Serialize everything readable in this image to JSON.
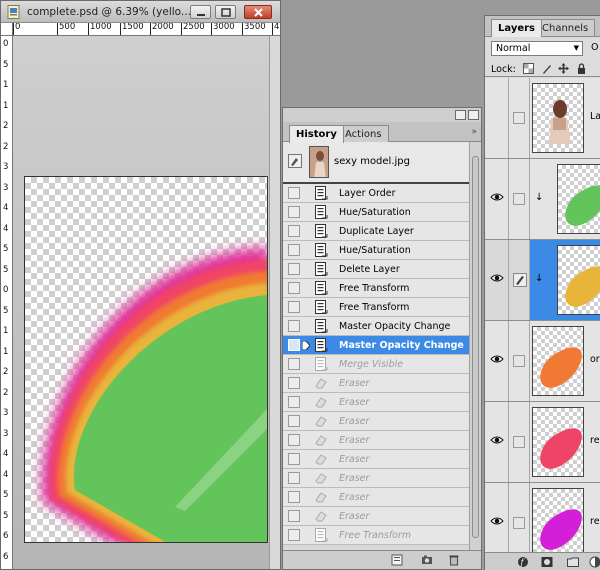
{
  "document": {
    "title": "complete.psd @ 6.39% (yello...",
    "ruler_top_labels": [
      "0",
      "500",
      "1000",
      "1500",
      "2000",
      "2500",
      "3000",
      "3500",
      "4"
    ],
    "ruler_left_labels": [
      "0",
      "5",
      "1",
      "1",
      "2",
      "2",
      "3",
      "3",
      "4",
      "4",
      "5",
      "5",
      "0",
      "5",
      "1",
      "1",
      "2",
      "2",
      "3",
      "3",
      "4",
      "4",
      "5",
      "5",
      "6",
      "6"
    ]
  },
  "history": {
    "tabs": [
      "History",
      "Actions"
    ],
    "snapshot_name": "sexy model.jpg",
    "items": [
      {
        "label": "Layer Order",
        "state": "normal"
      },
      {
        "label": "Hue/Saturation",
        "state": "normal"
      },
      {
        "label": "Duplicate Layer",
        "state": "normal"
      },
      {
        "label": "Hue/Saturation",
        "state": "normal"
      },
      {
        "label": "Delete Layer",
        "state": "normal"
      },
      {
        "label": "Free Transform",
        "state": "normal"
      },
      {
        "label": "Free Transform",
        "state": "normal"
      },
      {
        "label": "Master Opacity Change",
        "state": "normal"
      },
      {
        "label": "Master Opacity Change",
        "state": "selected"
      },
      {
        "label": "Merge Visible",
        "state": "dimmed"
      },
      {
        "label": "Eraser",
        "state": "dimmed"
      },
      {
        "label": "Eraser",
        "state": "dimmed"
      },
      {
        "label": "Eraser",
        "state": "dimmed"
      },
      {
        "label": "Eraser",
        "state": "dimmed"
      },
      {
        "label": "Eraser",
        "state": "dimmed"
      },
      {
        "label": "Eraser",
        "state": "dimmed"
      },
      {
        "label": "Eraser",
        "state": "dimmed"
      },
      {
        "label": "Eraser",
        "state": "dimmed"
      },
      {
        "label": "Free Transform",
        "state": "dimmed"
      }
    ]
  },
  "layers": {
    "tabs": [
      "Layers",
      "Channels"
    ],
    "blend_mode": "Normal",
    "opacity_label": "O",
    "lock_label": "Lock:",
    "rows": [
      {
        "name": "Lay",
        "visible": false,
        "thumb": "model",
        "selected": false,
        "clipped": false
      },
      {
        "name": "",
        "visible": true,
        "thumb": "green",
        "selected": false,
        "clipped": true
      },
      {
        "name": "",
        "visible": true,
        "thumb": "yellow",
        "selected": true,
        "clipped": true
      },
      {
        "name": "ora",
        "visible": true,
        "thumb": "orange",
        "selected": false,
        "clipped": false
      },
      {
        "name": "red",
        "visible": true,
        "thumb": "red",
        "selected": false,
        "clipped": false
      },
      {
        "name": "red",
        "visible": true,
        "thumb": "magenta",
        "selected": false,
        "clipped": false
      }
    ]
  },
  "colors": {
    "selection": "#3a8ae6",
    "band_magenta": "#e0339a",
    "band_red": "#f04466",
    "band_orange": "#f07a33",
    "band_yellow": "#e8b43a",
    "band_green": "#62c45a"
  }
}
